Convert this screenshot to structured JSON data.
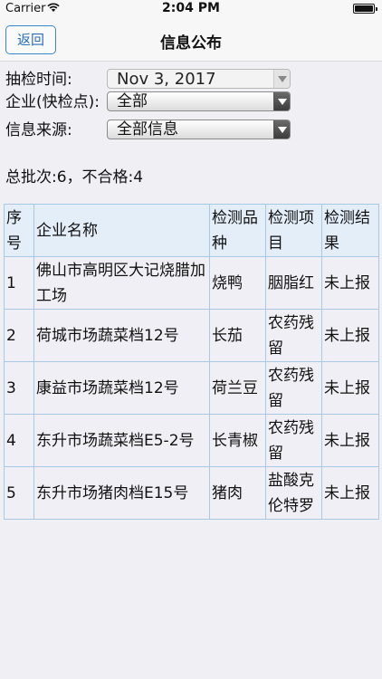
{
  "status_bar": {
    "carrier": "Carrier",
    "time": "2:04 PM"
  },
  "navbar": {
    "back_label": "返回",
    "title": "信息公布"
  },
  "filters": {
    "check_time_label": "抽检时间:",
    "check_time_value": "Nov 3, 2017",
    "enterprise_label": "企业(快检点):",
    "enterprise_value": "全部",
    "source_label": "信息来源:",
    "source_value": "全部信息"
  },
  "summary": "总批次:6，不合格:4",
  "table": {
    "headers": [
      "序号",
      "企业名称",
      "检测品种",
      "检测项目",
      "检测结果"
    ],
    "rows": [
      [
        "1",
        "佛山市高明区大记烧腊加工场",
        "烧鸭",
        "胭脂红",
        "未上报"
      ],
      [
        "2",
        "荷城市场蔬菜档12号",
        "长茄",
        "农药残留",
        "未上报"
      ],
      [
        "3",
        "康益市场蔬菜档12号",
        "荷兰豆",
        "农药残留",
        "未上报"
      ],
      [
        "4",
        "东升市场蔬菜档E5-2号",
        "长青椒",
        "农药残留",
        "未上报"
      ],
      [
        "5",
        "东升市场猪肉档E15号",
        "猪肉",
        "盐酸克伦特罗",
        "未上报"
      ]
    ]
  }
}
